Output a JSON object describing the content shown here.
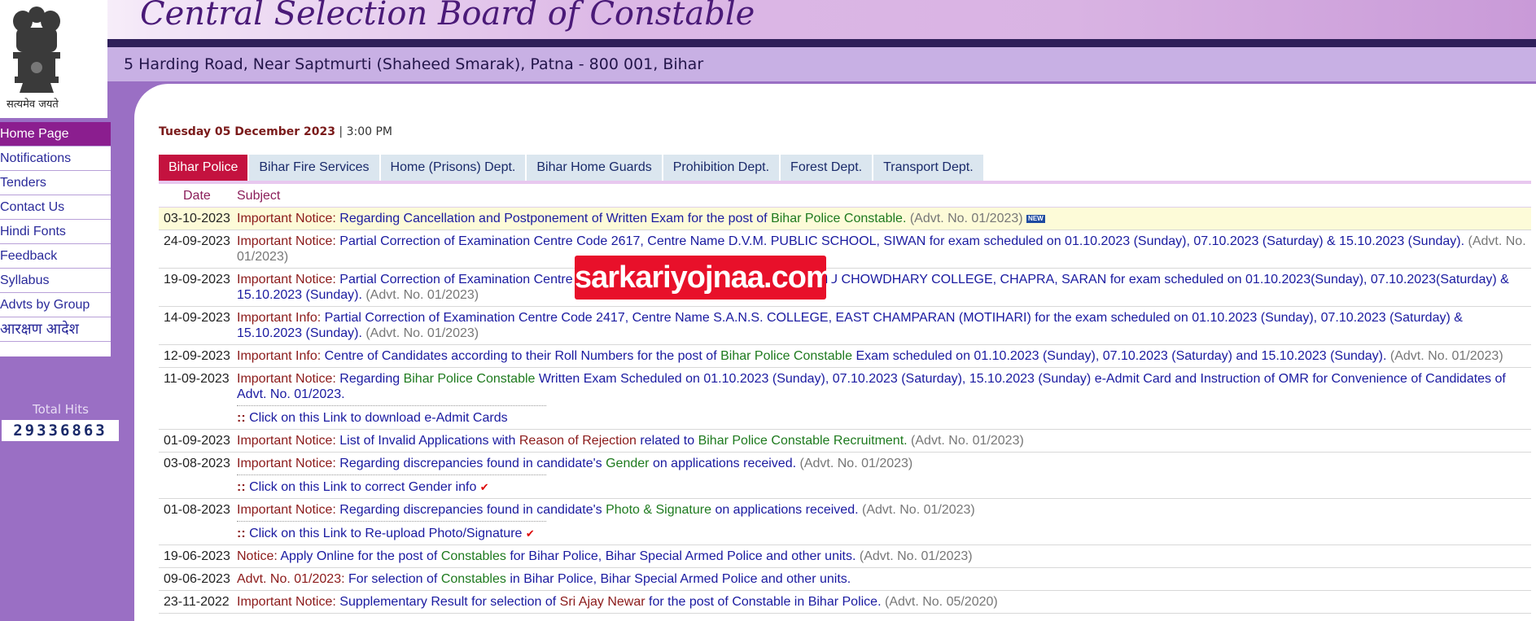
{
  "header": {
    "title": "Central Selection Board of Constable",
    "address": "5 Harding Road, Near Saptmurti (Shaheed Smarak), Patna - 800 001, Bihar",
    "motto": "सत्यमेव जयते"
  },
  "sidebar": {
    "items": [
      {
        "label": "Home Page"
      },
      {
        "label": "Notifications"
      },
      {
        "label": "Tenders"
      },
      {
        "label": "Contact Us"
      },
      {
        "label": "Hindi Fonts"
      },
      {
        "label": "Feedback"
      },
      {
        "label": "Syllabus"
      },
      {
        "label": "Advts by Group"
      },
      {
        "label": "आरक्षण आदेश"
      }
    ],
    "hits_label": "Total Hits",
    "hits_value": "29336863"
  },
  "main": {
    "date": "Tuesday 05 December 2023",
    "time_sep": "|",
    "time": "3:00 PM",
    "tabs": [
      {
        "label": "Bihar Police"
      },
      {
        "label": "Bihar Fire Services"
      },
      {
        "label": "Home (Prisons) Dept."
      },
      {
        "label": "Bihar Home Guards"
      },
      {
        "label": "Prohibition Dept."
      },
      {
        "label": "Forest Dept."
      },
      {
        "label": "Transport Dept."
      }
    ],
    "table": {
      "col_date": "Date",
      "col_subject": "Subject",
      "rows": [
        {
          "date": "03-10-2023",
          "label": "Important Notice:",
          "t1": "Regarding Cancellation and Postponement of Written Exam for the post of",
          "g1": "Bihar Police Constable.",
          "adv": "(Advt. No. 01/2023)",
          "badge": "NEW"
        },
        {
          "date": "24-09-2023",
          "label": "Important Notice:",
          "t1": "Partial Correction of Examination Centre Code 2617, Centre Name D.V.M. PUBLIC SCHOOL, SIWAN for exam scheduled on 01.10.2023 (Sunday), 07.10.2023 (Saturday) & 15.10.2023 (Sunday).",
          "adv": "(Advt. No. 01/2023)"
        },
        {
          "date": "19-09-2023",
          "label": "Important Notice:",
          "t1": "Partial Correction of Examination Centre Code 2518, Centre Name RAJENDRA SAHU CHOWDHARY COLLEGE, CHAPRA, SARAN for exam scheduled on 01.10.2023(Sunday), 07.10.2023(Saturday) & 15.10.2023 (Sunday).",
          "adv": "(Advt. No. 01/2023)"
        },
        {
          "date": "14-09-2023",
          "label": "Important Info:",
          "t1": "Partial Correction of Examination Centre Code 2417, Centre Name S.A.N.S. COLLEGE, EAST CHAMPARAN (MOTIHARI) for the exam scheduled on 01.10.2023 (Sunday), 07.10.2023 (Saturday) & 15.10.2023 (Sunday).",
          "adv": "(Advt. No. 01/2023)"
        },
        {
          "date": "12-09-2023",
          "label": "Important Info:",
          "t1": "Centre of Candidates according to their Roll Numbers for the post of",
          "g1": "Bihar Police Constable",
          "t2": "Exam scheduled on 01.10.2023 (Sunday), 07.10.2023 (Saturday) and 15.10.2023 (Sunday).",
          "adv": "(Advt. No. 01/2023)"
        },
        {
          "date": "11-09-2023",
          "label": "Important Notice:",
          "t1": "Regarding",
          "g1": "Bihar Police Constable",
          "t2": "Written Exam Scheduled on 01.10.2023 (Sunday), 07.10.2023 (Saturday), 15.10.2023 (Sunday) e-Admit Card and Instruction of OMR for Convenience of Candidates of Advt. No. 01/2023.",
          "link": "Click on this Link to download e-Admit Cards"
        },
        {
          "date": "01-09-2023",
          "label": "Important Notice:",
          "t1": "List of Invalid Applications with",
          "r1": "Reason of Rejection",
          "t2": "related to",
          "g1": "Bihar Police Constable Recruitment.",
          "adv": "(Advt. No. 01/2023)"
        },
        {
          "date": "03-08-2023",
          "label": "Important Notice:",
          "t1": "Regarding discrepancies found in candidate's",
          "g1": "Gender",
          "t2": "on applications received.",
          "adv": "(Advt. No. 01/2023)",
          "link": "Click on this Link to correct Gender info",
          "tick": "✔"
        },
        {
          "date": "01-08-2023",
          "label": "Important Notice:",
          "t1": "Regarding discrepancies found in candidate's",
          "g1": "Photo & Signature",
          "t2": "on applications received.",
          "adv": "(Advt. No. 01/2023)",
          "link": "Click on this Link to Re-upload Photo/Signature",
          "tick": "✔"
        },
        {
          "date": "19-06-2023",
          "label": "Notice:",
          "t1": "Apply Online for the post of",
          "g1": "Constables",
          "t2": "for Bihar Police, Bihar Special Armed Police and other units.",
          "adv": "(Advt. No. 01/2023)"
        },
        {
          "date": "09-06-2023",
          "label": "Advt. No. 01/2023:",
          "t1": "For selection of",
          "g1": "Constables",
          "t2": "in Bihar Police, Bihar Special Armed Police and other units."
        },
        {
          "date": "23-11-2022",
          "label": "Important Notice:",
          "t1": "Supplementary Result for selection of",
          "r1": "Sri Ajay Newar",
          "t2": "for the post of Constable in Bihar Police.",
          "adv": "(Advt. No. 05/2020)"
        }
      ]
    }
  },
  "watermark": "sarkariyojnaa.com",
  "colors": {
    "header_title": "#4a1a78",
    "sidebar_bg": "#9a6fc4",
    "active_menu": "#8b1e8f",
    "active_tab": "#c4123f",
    "link_blue": "#1a1aa0",
    "label_red": "#8b1a1a",
    "highlight_green": "#1e7a1e",
    "watermark_red": "#e8102a"
  }
}
